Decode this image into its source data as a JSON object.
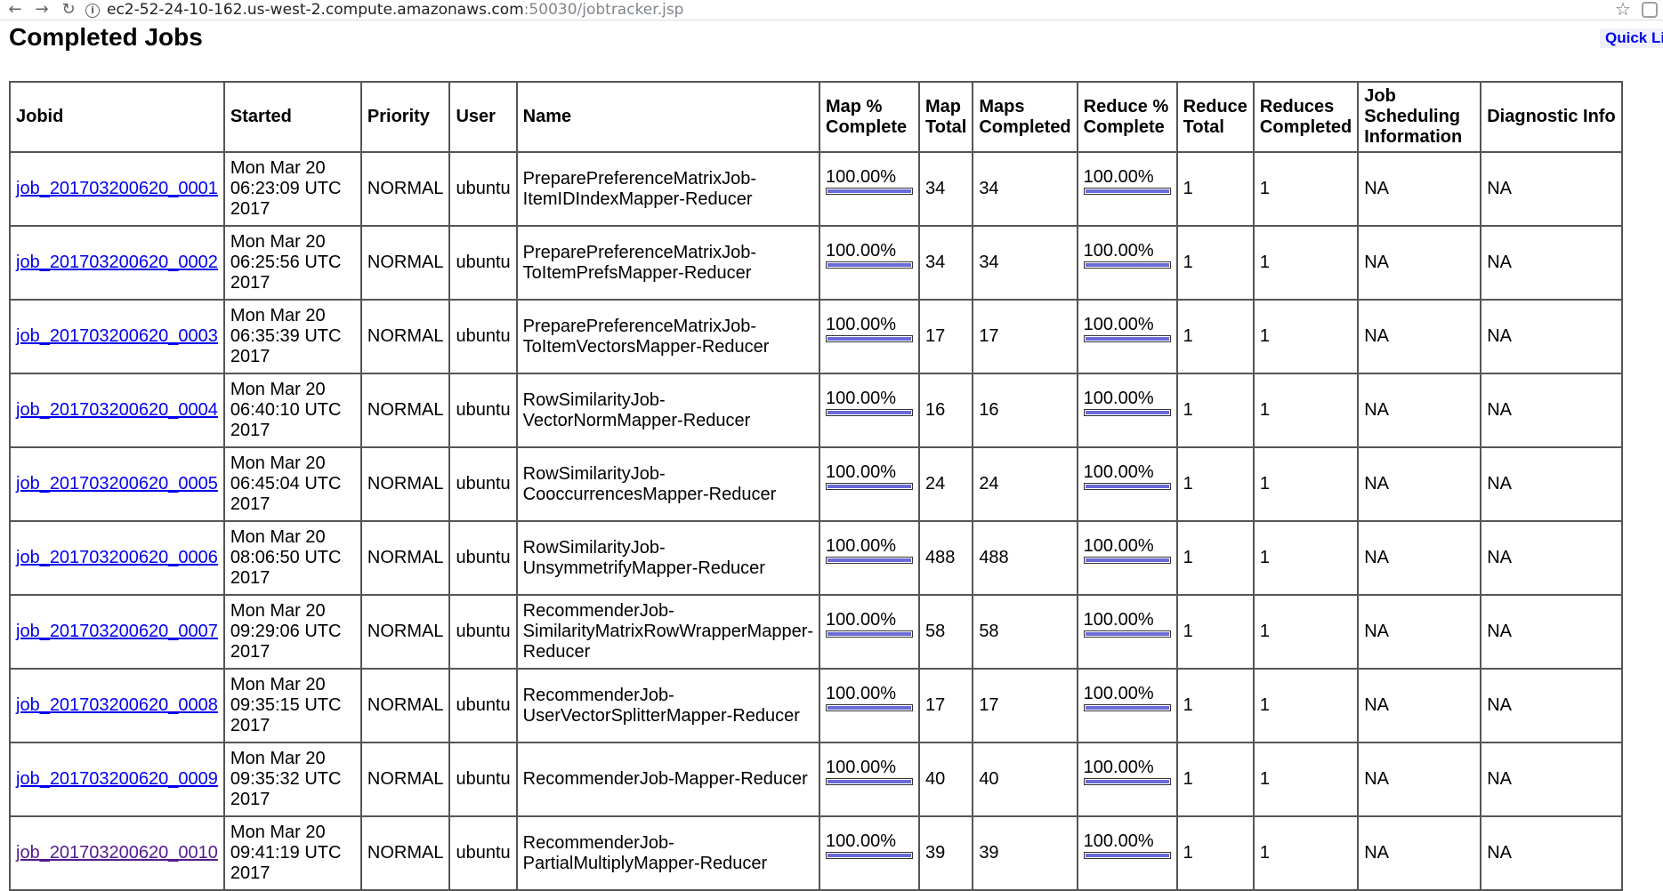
{
  "browser": {
    "back_glyph": "←",
    "forward_glyph": "→",
    "reload_glyph": "↻",
    "info_glyph": "i",
    "url_host": "ec2-52-24-10-162.us-west-2.compute.amazonaws.com",
    "url_path": ":50030/jobtracker.jsp",
    "star_glyph": "☆"
  },
  "page": {
    "title": "Completed Jobs",
    "quick_links": "Quick Links"
  },
  "table": {
    "headers": {
      "jobid": "Jobid",
      "started": "Started",
      "priority": "Priority",
      "user": "User",
      "name": "Name",
      "map_pct": "Map % Complete",
      "map_total": "Map Total",
      "maps_completed": "Maps Completed",
      "reduce_pct": "Reduce % Complete",
      "reduce_total": "Reduce Total",
      "reduces_completed": "Reduces Completed",
      "scheduling": "Job Scheduling Information",
      "diagnostic": "Diagnostic Info"
    },
    "rows": [
      {
        "jobid": "job_201703200620_0001",
        "started": "Mon Mar 20 06:23:09 UTC 2017",
        "priority": "NORMAL",
        "user": "ubuntu",
        "name": "PreparePreferenceMatrixJob-ItemIDIndexMapper-Reducer",
        "map_pct": "100.00%",
        "map_fill": 100,
        "map_total": "34",
        "maps_completed": "34",
        "reduce_pct": "100.00%",
        "reduce_fill": 100,
        "reduce_total": "1",
        "reduces_completed": "1",
        "scheduling": "NA",
        "diagnostic": "NA"
      },
      {
        "jobid": "job_201703200620_0002",
        "started": "Mon Mar 20 06:25:56 UTC 2017",
        "priority": "NORMAL",
        "user": "ubuntu",
        "name": "PreparePreferenceMatrixJob-ToItemPrefsMapper-Reducer",
        "map_pct": "100.00%",
        "map_fill": 100,
        "map_total": "34",
        "maps_completed": "34",
        "reduce_pct": "100.00%",
        "reduce_fill": 100,
        "reduce_total": "1",
        "reduces_completed": "1",
        "scheduling": "NA",
        "diagnostic": "NA"
      },
      {
        "jobid": "job_201703200620_0003",
        "started": "Mon Mar 20 06:35:39 UTC 2017",
        "priority": "NORMAL",
        "user": "ubuntu",
        "name": "PreparePreferenceMatrixJob-ToItemVectorsMapper-Reducer",
        "map_pct": "100.00%",
        "map_fill": 100,
        "map_total": "17",
        "maps_completed": "17",
        "reduce_pct": "100.00%",
        "reduce_fill": 100,
        "reduce_total": "1",
        "reduces_completed": "1",
        "scheduling": "NA",
        "diagnostic": "NA"
      },
      {
        "jobid": "job_201703200620_0004",
        "started": "Mon Mar 20 06:40:10 UTC 2017",
        "priority": "NORMAL",
        "user": "ubuntu",
        "name": "RowSimilarityJob-VectorNormMapper-Reducer",
        "map_pct": "100.00%",
        "map_fill": 100,
        "map_total": "16",
        "maps_completed": "16",
        "reduce_pct": "100.00%",
        "reduce_fill": 100,
        "reduce_total": "1",
        "reduces_completed": "1",
        "scheduling": "NA",
        "diagnostic": "NA"
      },
      {
        "jobid": "job_201703200620_0005",
        "started": "Mon Mar 20 06:45:04 UTC 2017",
        "priority": "NORMAL",
        "user": "ubuntu",
        "name": "RowSimilarityJob-CooccurrencesMapper-Reducer",
        "map_pct": "100.00%",
        "map_fill": 100,
        "map_total": "24",
        "maps_completed": "24",
        "reduce_pct": "100.00%",
        "reduce_fill": 100,
        "reduce_total": "1",
        "reduces_completed": "1",
        "scheduling": "NA",
        "diagnostic": "NA"
      },
      {
        "jobid": "job_201703200620_0006",
        "started": "Mon Mar 20 08:06:50 UTC 2017",
        "priority": "NORMAL",
        "user": "ubuntu",
        "name": "RowSimilarityJob-UnsymmetrifyMapper-Reducer",
        "map_pct": "100.00%",
        "map_fill": 100,
        "map_total": "488",
        "maps_completed": "488",
        "reduce_pct": "100.00%",
        "reduce_fill": 100,
        "reduce_total": "1",
        "reduces_completed": "1",
        "scheduling": "NA",
        "diagnostic": "NA"
      },
      {
        "jobid": "job_201703200620_0007",
        "started": "Mon Mar 20 09:29:06 UTC 2017",
        "priority": "NORMAL",
        "user": "ubuntu",
        "name": "RecommenderJob-SimilarityMatrixRowWrapperMapper-Reducer",
        "map_pct": "100.00%",
        "map_fill": 100,
        "map_total": "58",
        "maps_completed": "58",
        "reduce_pct": "100.00%",
        "reduce_fill": 100,
        "reduce_total": "1",
        "reduces_completed": "1",
        "scheduling": "NA",
        "diagnostic": "NA"
      },
      {
        "jobid": "job_201703200620_0008",
        "started": "Mon Mar 20 09:35:15 UTC 2017",
        "priority": "NORMAL",
        "user": "ubuntu",
        "name": "RecommenderJob-UserVectorSplitterMapper-Reducer",
        "map_pct": "100.00%",
        "map_fill": 100,
        "map_total": "17",
        "maps_completed": "17",
        "reduce_pct": "100.00%",
        "reduce_fill": 100,
        "reduce_total": "1",
        "reduces_completed": "1",
        "scheduling": "NA",
        "diagnostic": "NA"
      },
      {
        "jobid": "job_201703200620_0009",
        "started": "Mon Mar 20 09:35:32 UTC 2017",
        "priority": "NORMAL",
        "user": "ubuntu",
        "name": "RecommenderJob-Mapper-Reducer",
        "map_pct": "100.00%",
        "map_fill": 100,
        "map_total": "40",
        "maps_completed": "40",
        "reduce_pct": "100.00%",
        "reduce_fill": 100,
        "reduce_total": "1",
        "reduces_completed": "1",
        "scheduling": "NA",
        "diagnostic": "NA"
      },
      {
        "jobid": "job_201703200620_0010",
        "started": "Mon Mar 20 09:41:19 UTC 2017",
        "priority": "NORMAL",
        "user": "ubuntu",
        "name": "RecommenderJob-PartialMultiplyMapper-Reducer",
        "map_pct": "100.00%",
        "map_fill": 100,
        "map_total": "39",
        "maps_completed": "39",
        "reduce_pct": "100.00%",
        "reduce_fill": 100,
        "reduce_total": "1",
        "reduces_completed": "1",
        "scheduling": "NA",
        "diagnostic": "NA",
        "visited": true
      }
    ]
  }
}
